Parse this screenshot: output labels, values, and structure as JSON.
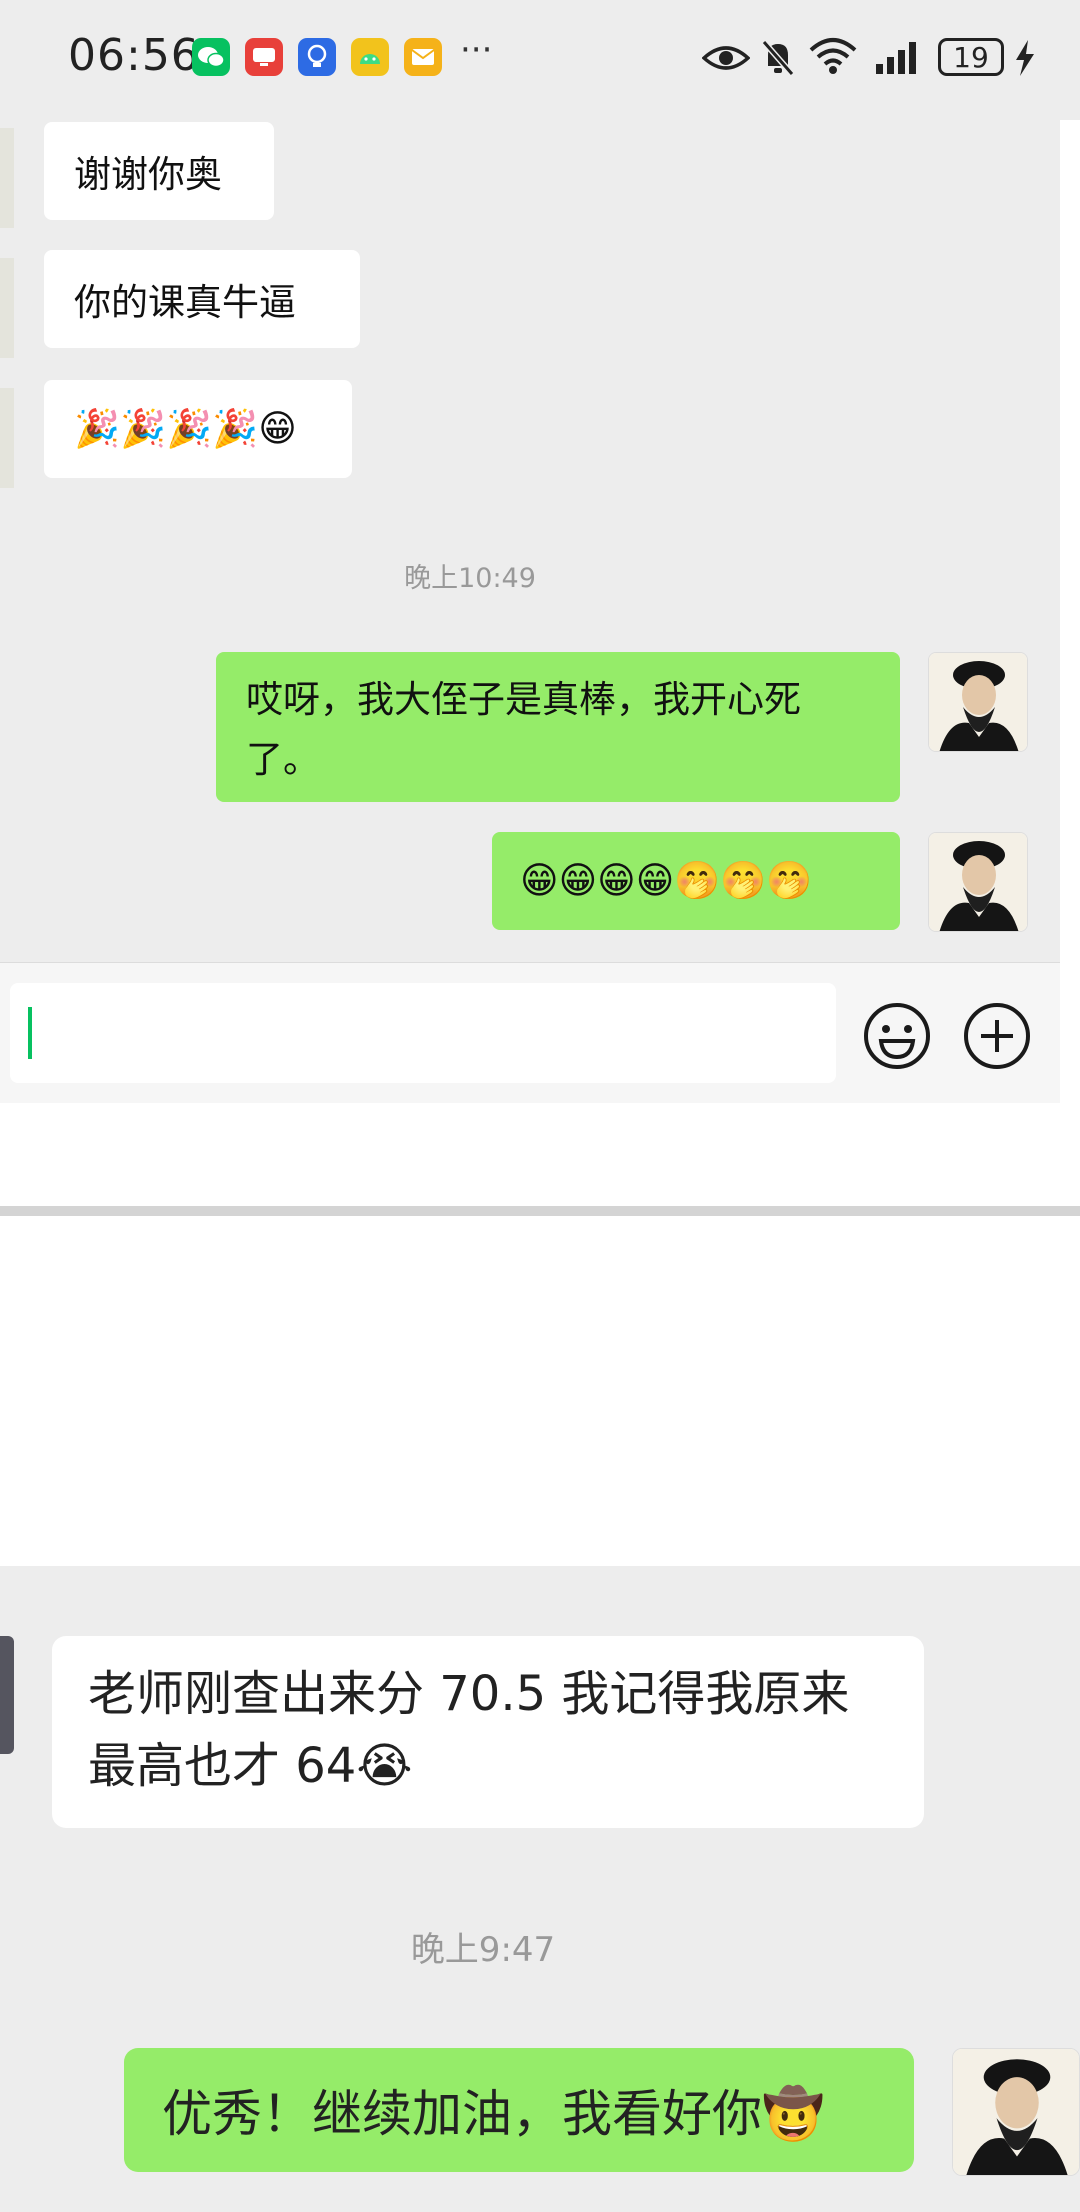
{
  "status_bar": {
    "time": "06:56",
    "battery": "19",
    "more": "···",
    "app_icons": [
      "wechat-icon",
      "xiaohongshu-icon",
      "lightbulb-icon",
      "android-icon",
      "mail-icon"
    ]
  },
  "chat_top": {
    "received": [
      {
        "text": "谢谢你奥"
      },
      {
        "text": "你的课真牛逼"
      },
      {
        "text": "🎉🎉🎉🎉😁"
      }
    ],
    "timestamp": "晚上10:49",
    "sent": [
      {
        "text": "哎呀，我大侄子是真棒，我开心死了。"
      },
      {
        "text": "😁😁😁😁🤭🤭🤭"
      }
    ]
  },
  "chat_bottom": {
    "received": {
      "text": "老师刚查出来分 70.5 我记得我原来最高也才 64😭"
    },
    "timestamp": "晚上9:47",
    "sent": {
      "text": "优秀！继续加油，我看好你🤠"
    }
  },
  "colors": {
    "sent_bubble": "#95ec69",
    "chat_bg": "#ededed",
    "cursor": "#07c160"
  }
}
